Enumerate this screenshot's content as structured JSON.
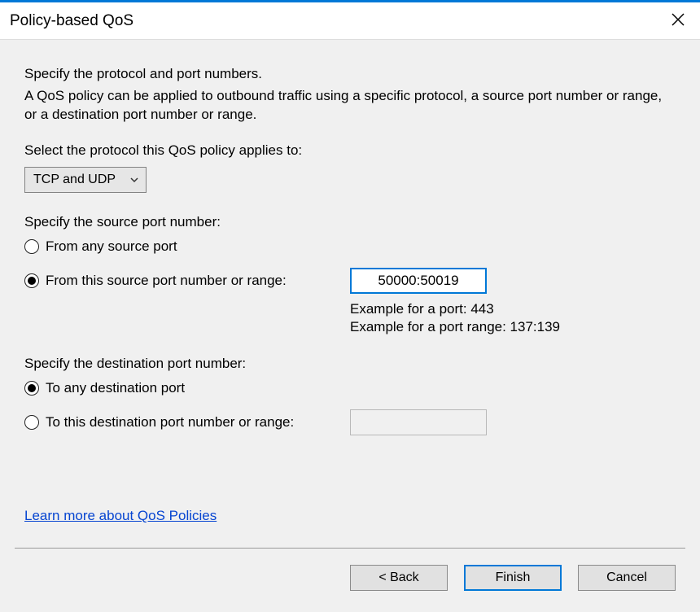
{
  "titlebar": {
    "title": "Policy-based QoS"
  },
  "instr": {
    "main": "Specify the protocol and port numbers.",
    "sub": "A QoS policy can be applied to outbound traffic using a specific protocol, a source port number or range, or a destination port number or range."
  },
  "protocol": {
    "label": "Select the protocol this QoS policy applies to:",
    "value": "TCP and UDP"
  },
  "source": {
    "label": "Specify the source port number:",
    "opt_any": "From any source port",
    "opt_specific": "From this source port number or range:",
    "value": "50000:50019",
    "example1": "Example for a port: 443",
    "example2": "Example for a port range: 137:139"
  },
  "dest": {
    "label": "Specify the destination port number:",
    "opt_any": "To any destination port",
    "opt_specific": "To this destination port number or range:",
    "value": ""
  },
  "link": "Learn more about QoS Policies",
  "buttons": {
    "back": "< Back",
    "finish": "Finish",
    "cancel": "Cancel"
  }
}
